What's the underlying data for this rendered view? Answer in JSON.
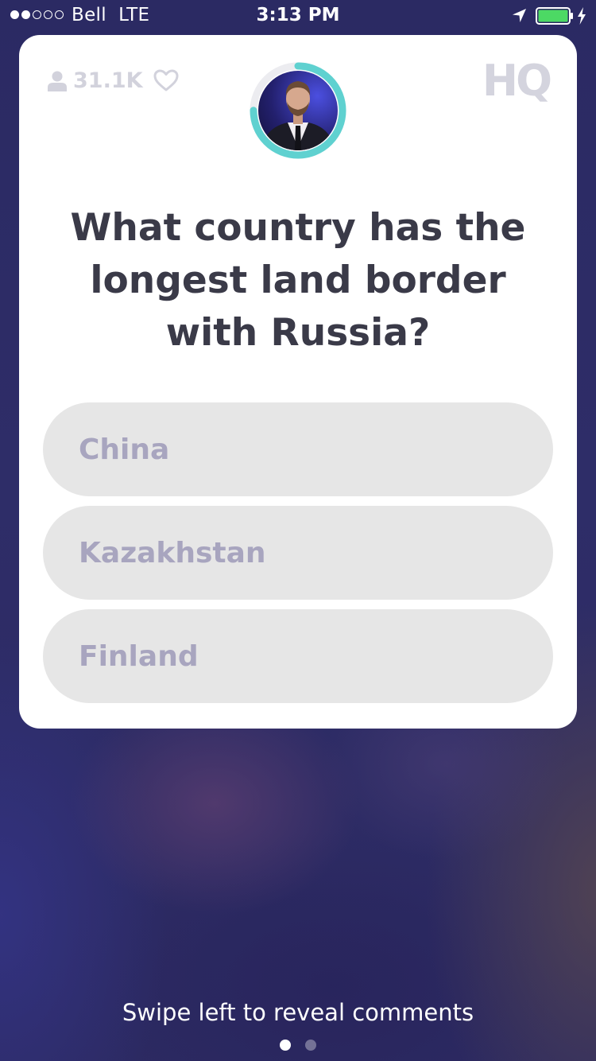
{
  "status_bar": {
    "carrier": "Bell",
    "network": "LTE",
    "time": "3:13 PM",
    "signal_bars_filled": 2,
    "signal_bars_total": 5,
    "battery_level": 1.0,
    "battery_color": "#4cd964",
    "charging": true
  },
  "header": {
    "viewer_count": "31.1K",
    "logo": "HQ",
    "timer_color": "#5fd1d0",
    "timer_progress": 0.75
  },
  "question": {
    "text": "What country has the longest land border with Russia?"
  },
  "answers": [
    {
      "label": "China"
    },
    {
      "label": "Kazakhstan"
    },
    {
      "label": "Finland"
    }
  ],
  "footer": {
    "hint": "Swipe left to reveal comments",
    "page_index": 1,
    "page_count": 2
  }
}
